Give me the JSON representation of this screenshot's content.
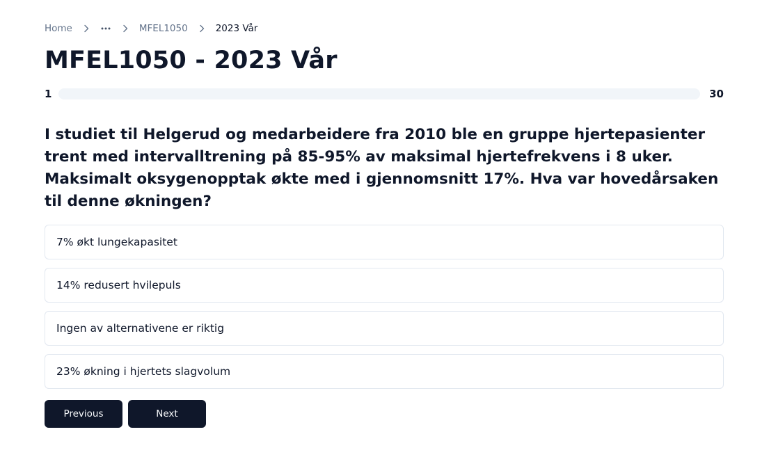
{
  "breadcrumb": {
    "home": "Home",
    "ellipsis_icon": "more-horizontal-icon",
    "separator_icon": "chevron-right-icon",
    "course": "MFEL1050",
    "current": "2023 Vår"
  },
  "title": "MFEL1050 - 2023 Vår",
  "progress": {
    "current": "1",
    "total": "30",
    "fraction": 0.033
  },
  "question": {
    "text": "I studiet til Helgerud og medarbeidere fra 2010 ble en gruppe hjertepasienter trent med intervalltrening på 85-95% av maksimal hjertefrekvens i 8 uker. Maksimalt oksygenopptak økte med i gjennomsnitt 17%. Hva var hovedårsaken til denne økningen?"
  },
  "options": [
    {
      "label": "7% økt lungekapasitet"
    },
    {
      "label": "14% redusert hvilepuls"
    },
    {
      "label": "Ingen av alternativene er riktig"
    },
    {
      "label": "23% økning i hjertets slagvolum"
    }
  ],
  "nav": {
    "previous_label": "Previous",
    "next_label": "Next"
  },
  "colors": {
    "primary": "#0f172a",
    "muted_text": "#64748b",
    "border": "#e2e8f0",
    "track": "#f1f5f9"
  }
}
